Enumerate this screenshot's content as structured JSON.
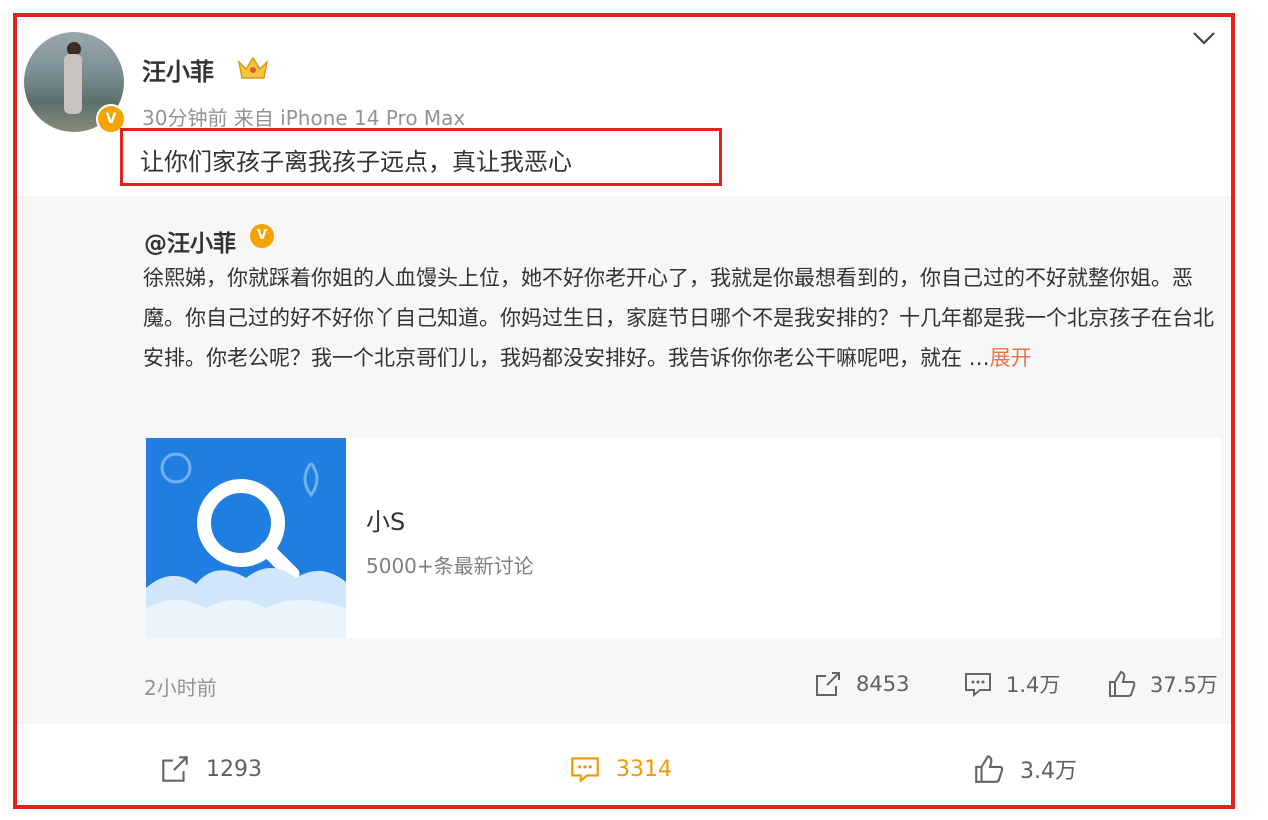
{
  "post": {
    "author": "汪小菲",
    "meta": "30分钟前  来自 iPhone 14 Pro Max",
    "text": "让你们家孩子离我孩子远点，真让我恶心"
  },
  "repost": {
    "author": "@汪小菲",
    "text": "徐熙娣，你就踩着你姐的人血馒头上位，她不好你老开心了，我就是你最想看到的，你自己过的不好就整你姐。恶魔。你自己过的好不好你丫自己知道。你妈过生日，家庭节日哪个不是我安排的？十几年都是我一个北京孩子在台北安排。你老公呢？我一个北京哥们儿，我妈都没安排好。我告诉你你老公干嘛呢吧，就在 …",
    "expand_label": "展开",
    "link_card": {
      "title": "小S",
      "subtitle": "5000+条最新讨论"
    },
    "time": "2小时前",
    "stats": {
      "reposts": "8453",
      "comments": "1.4万",
      "likes": "37.5万"
    }
  },
  "actions": {
    "reposts": "1293",
    "comments": "3314",
    "likes": "3.4万"
  },
  "colors": {
    "accent": "#f09a00",
    "highlight_border": "#e0241d",
    "link": "#eb7350"
  },
  "icons": [
    "crown-icon",
    "verified-icon",
    "chevron-down-icon",
    "search-icon",
    "repost-icon",
    "comment-icon",
    "like-icon"
  ]
}
